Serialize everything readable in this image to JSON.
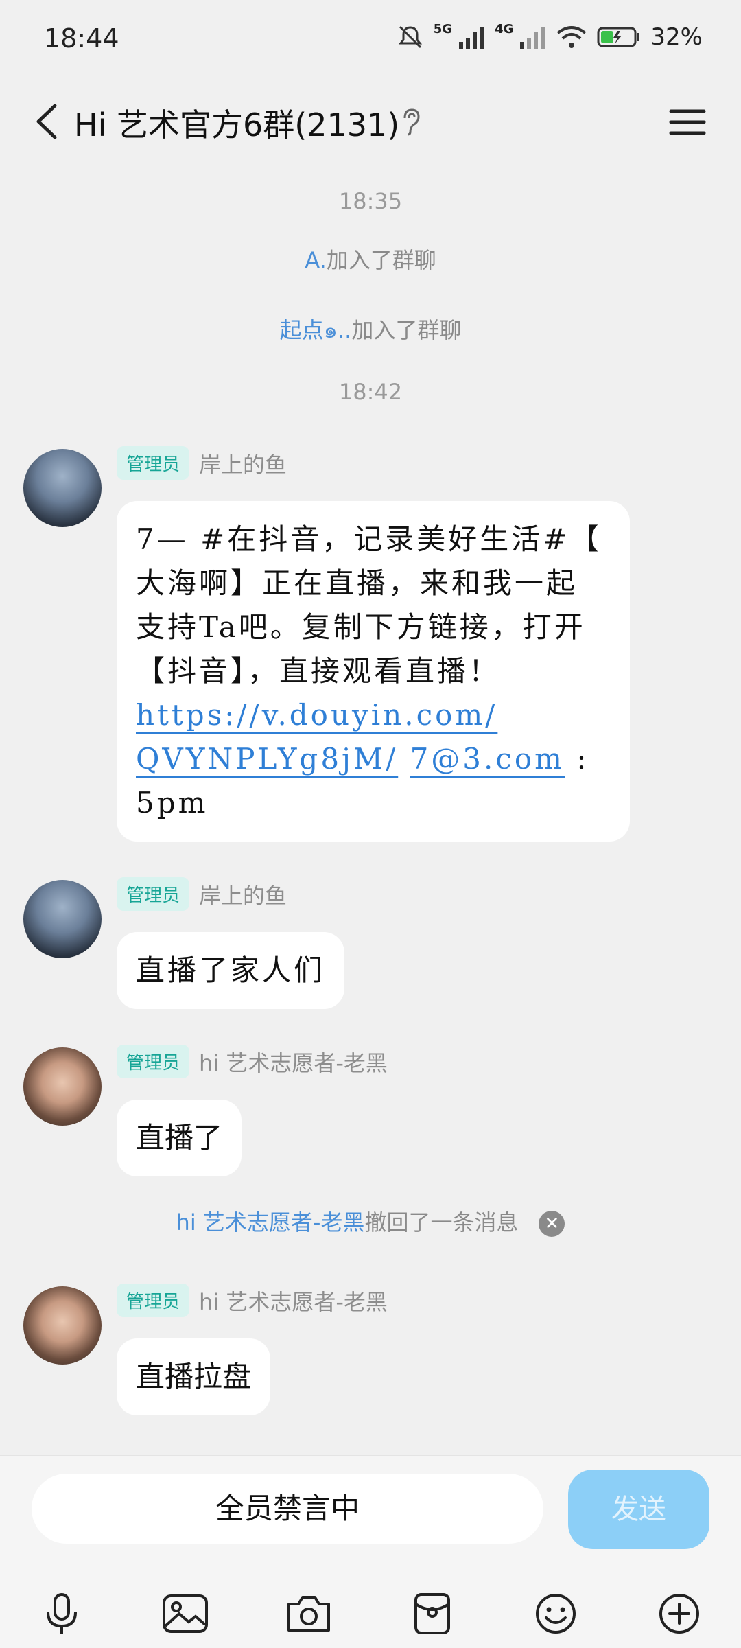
{
  "status": {
    "time": "18:44",
    "signal1": "5G",
    "signal2": "4G",
    "battery": "32%"
  },
  "header": {
    "title": "Hi 艺术官方6群(2131)"
  },
  "chat": {
    "time1": "18:35",
    "join1_name": "A.",
    "join1_text": "加入了群聊",
    "join2_name": "起点๑..",
    "join2_text": "加入了群聊",
    "time2": "18:42",
    "messages": [
      {
        "badge": "管理员",
        "sender": "岸上的鱼",
        "text_line1": "7— #在抖音，记录美好生活#【",
        "text_line2": "大海啊】正在直播，来和我一起",
        "text_line3": "支持Ta吧。复制下方链接，打开",
        "text_line4": "【抖音】，直接观看直播！",
        "link1": "https://v.douyin.com/",
        "link2": "QVYNPLYg8jM/",
        "link3": "7@3.com",
        "tail1": " :",
        "tail2": "5pm"
      },
      {
        "badge": "管理员",
        "sender": "岸上的鱼",
        "text": "直播了家人们"
      },
      {
        "badge": "管理员",
        "sender": "hi 艺术志愿者-老黑",
        "text": "直播了"
      },
      {
        "badge": "管理员",
        "sender": "hi 艺术志愿者-老黑",
        "text": "直播拉盘"
      }
    ],
    "recall_name": "hi 艺术志愿者-老黑",
    "recall_text": "撤回了一条消息"
  },
  "input": {
    "mute_text": "全员禁言中",
    "send_label": "发送"
  },
  "icons": [
    "mic-icon",
    "image-icon",
    "camera-icon",
    "red-packet-icon",
    "emoji-icon",
    "plus-icon"
  ]
}
